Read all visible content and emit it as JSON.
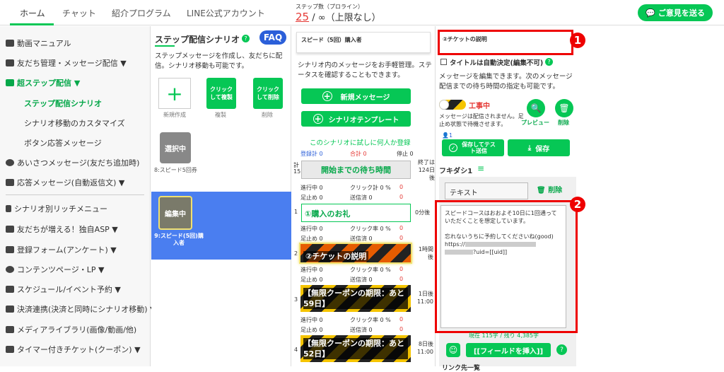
{
  "header": {
    "tabs": [
      "ホーム",
      "チャット",
      "紹介プログラム",
      "LINE公式アカウント"
    ],
    "step_label": "ステップ数（プロライン）",
    "step_used": "25",
    "step_limit": "/ ∞（上限なし）",
    "feedback_label": "ご意見を送る"
  },
  "sidebar": {
    "items": [
      "動画マニュアル",
      "友だち管理・メッセージ配信 ▼",
      "超ステップ配信 ▼",
      "ステップ配信シナリオ",
      "シナリオ移動のカスタマイズ",
      "ボタン応答メッセージ",
      "あいさつメッセージ(友だち追加時)",
      "応答メッセージ(自動返信文) ▼",
      "シナリオ別リッチメニュー",
      "友だちが増える！独自ASP ▼",
      "登録フォーム(アンケート) ▼",
      "コンテンツページ・LP ▼",
      "スケジュール/イベント予約 ▼",
      "決済連携(決済と同時にシナリオ移動) ▼",
      "メディアライブラリ(画像/動画/他)",
      "タイマー付きチケット(クーポン) ▼"
    ]
  },
  "scenario": {
    "title": "ステップ配信シナリオ",
    "faq": "FAQ",
    "desc": "ステップメッセージを作成し、友だちに配信。シナリオ移動も可能です。",
    "new_label": "新規作成",
    "copy_btn": "クリックして複製",
    "copy_label": "複製",
    "delete_btn": "クリックして削除",
    "delete_label": "削除",
    "item1_badge": "選択中",
    "item1_name": "8:スピード5回券",
    "item2_badge": "編集中",
    "item2_name": "9:スピード(5回)購入者"
  },
  "messages": {
    "scenario_name": "スピード（5回）購入者",
    "desc": "シナリオ内のメッセージをお手軽管理。ステータスを確認することもできます。",
    "new_message": "新規メッセージ",
    "template": "シナリオテンプレート",
    "trial_link": "このシナリオに試しに何人か登録",
    "stats_head": [
      "登録計 0",
      "合計 0",
      "停止 0"
    ],
    "start_total": "計15",
    "start_label": "開始までの待ち時間",
    "end_label": "終了は124日後",
    "row_stats_a": [
      "進行中 0",
      "クリック計 0 %",
      "0"
    ],
    "row_stats_b": [
      "足止め 0",
      "送信済 0",
      "0"
    ],
    "row_stats_c": [
      "進行中 0",
      "クリック率 0 %",
      "0"
    ],
    "steps": [
      {
        "num": "1",
        "title": "①購入のお礼",
        "timing": "0分後"
      },
      {
        "num": "2",
        "title": "②チケットの説明",
        "timing": "1時間後"
      },
      {
        "num": "3",
        "title": "【無限クーポンの期限：あと59日】",
        "timing": "1日後 11:00"
      },
      {
        "num": "4",
        "title": "【無限クーポンの期限：あと52日】",
        "timing": "8日後 11:00"
      }
    ]
  },
  "editor": {
    "title": "②チケットの説明",
    "auto_title": "タイトルは自動決定(編集不可)",
    "desc": "メッセージを編集できます。次のメッセージ配信までの待ち時間の指定も可能です。",
    "wip": "工事中",
    "wip_note": "メッセージは配信されません。足止め状態で待機させます。",
    "preview": "プレビュー",
    "delete": "削除",
    "count_user": "1",
    "save_test": "保存してテスト送信",
    "save": "保存",
    "bubble": "フキダシ1",
    "type": "テキスト",
    "bubble_delete": "削除",
    "body_lines": [
      "スピードコースはおおよそ10日に1回通っていただくことを想定しています。",
      "",
      "忘れないうちに予約してくださいね(good)",
      "https://",
      "?uid=[[uid]]"
    ],
    "counter": "現在 115字 / 残り 4,385字",
    "insert_field": "[[フィールドを挿入]]",
    "link_label": "リンク先一覧",
    "badge1": "1",
    "badge2": "2"
  }
}
